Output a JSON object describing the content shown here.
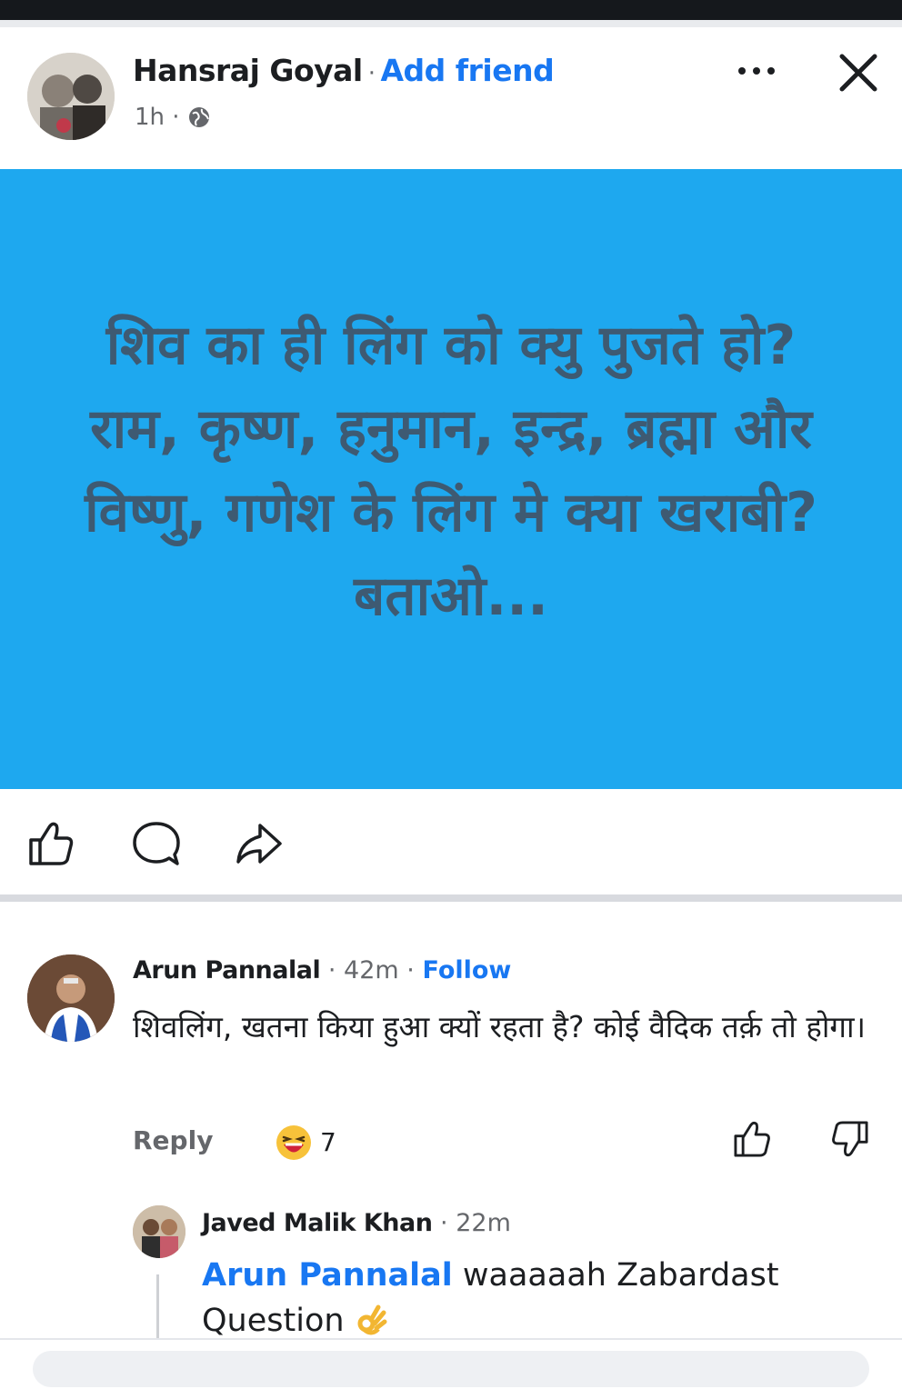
{
  "colors": {
    "accent": "#1877f2",
    "banner_background": "#1ea8ef",
    "banner_text": "#3e5a72",
    "secondary_text": "#65676b"
  },
  "post": {
    "author": "Hansraj Goyal",
    "separator": "·",
    "add_friend_label": "Add friend",
    "time": "1h",
    "privacy_icon": "globe-icon",
    "banner_text": "शिव का ही लिंग को क्यु पुजते हो? राम, कृष्ण, हनुमान, इन्द्र, ब्रह्मा और विष्णु, गणेश के लिंग मे क्या खराबी? बताओ...",
    "action_icons": [
      "like-icon",
      "comment-icon",
      "share-icon"
    ]
  },
  "comments": [
    {
      "author": "Arun Pannalal",
      "time": "42m",
      "follow_label": "Follow",
      "text": "शिवलिंग, खतना किया हुआ क्यों रहता है? कोई वैदिक तर्क़ तो होगा।",
      "reply_label": "Reply",
      "reaction_icon": "haha-emoji-icon",
      "reaction_count": "7",
      "replies": [
        {
          "author": "Javed Malik Khan",
          "time": "22m",
          "mention": "Arun Pannalal",
          "text": "waaaaah Zabardast Question",
          "emoji_icon": "ok-hand-icon"
        }
      ]
    }
  ]
}
